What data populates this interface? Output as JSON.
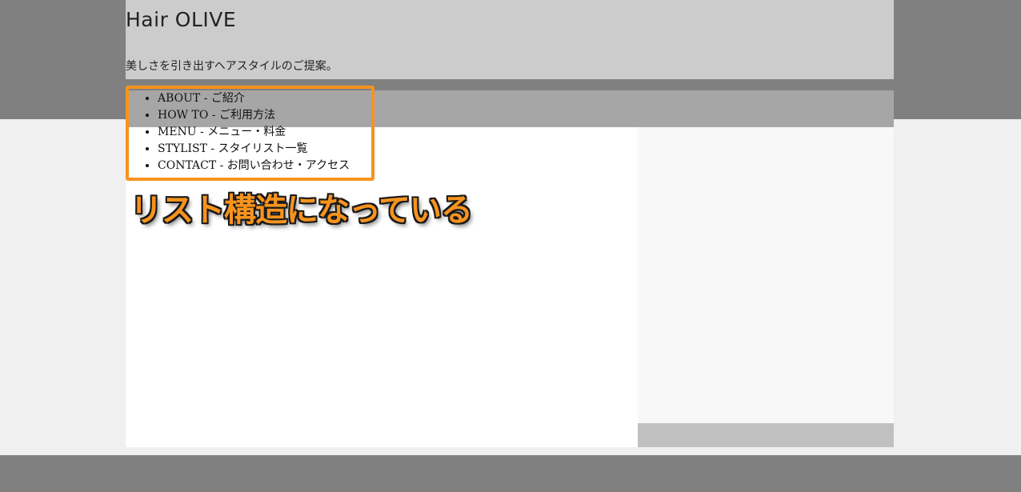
{
  "header": {
    "site_title": "Hair OLIVE",
    "tagline": "美しさを引き出すヘアスタイルのご提案。"
  },
  "nav": {
    "items": [
      {
        "label": "ABOUT - ご紹介"
      },
      {
        "label": "HOW TO - ご利用方法"
      },
      {
        "label": "MENU - メニュー・料金"
      },
      {
        "label": "STYLIST - スタイリスト一覧"
      },
      {
        "label": "CONTACT - お問い合わせ・アクセス"
      }
    ]
  },
  "annotation": {
    "text": "リスト構造になっている",
    "highlight_color": "#f7931e"
  },
  "colors": {
    "band": "#808080",
    "header_bg": "#cccccc",
    "navbar_bg": "#a6a6a6",
    "main_bg": "#ffffff",
    "sidebar_bg": "#f8f8f8",
    "sidebar_footer_bg": "#c0c0c0"
  }
}
